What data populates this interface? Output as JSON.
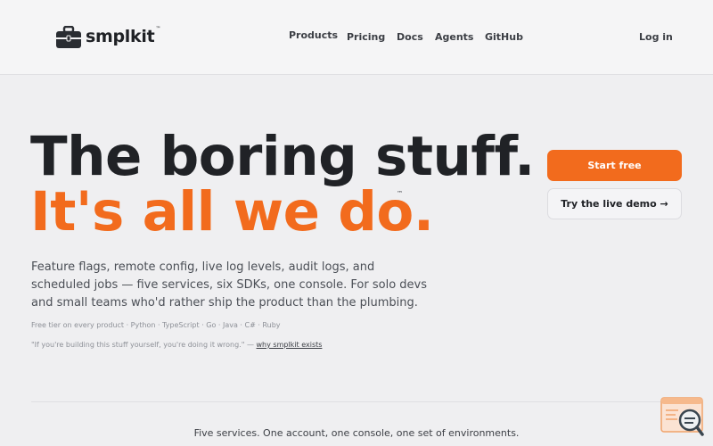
{
  "brand": {
    "name": "smplkit",
    "tm": "™"
  },
  "nav": {
    "items": [
      {
        "label": "Products"
      },
      {
        "label": "Pricing"
      },
      {
        "label": "Docs"
      },
      {
        "label": "Agents"
      },
      {
        "label": "GitHub"
      }
    ],
    "login": "Log in"
  },
  "hero": {
    "headline_line1": "The boring stuff.",
    "headline_line2": "It's all we do.",
    "tm": "™",
    "description": "Feature flags, remote config, live log levels, audit logs, and scheduled jobs — five services, six SDKs, one console. For solo devs and small teams who'd rather ship the product than the plumbing.",
    "tiers": "Free tier on every product · Python · TypeScript · Go · Java · C# · Ruby",
    "quote": "\"If you're building this stuff yourself, you're doing it wrong.\" — ",
    "quote_link": "why smplkit exists"
  },
  "cta": {
    "primary": "Start free",
    "secondary": "Try the live demo →"
  },
  "footer": {
    "tagline": "Five services. One account, one console, one set of environments."
  },
  "colors": {
    "accent": "#f26b1d",
    "text_dark": "#202226",
    "background": "#efeff1"
  },
  "icons": {
    "logo": "briefcase-icon",
    "chat": "chat-support-icon"
  }
}
